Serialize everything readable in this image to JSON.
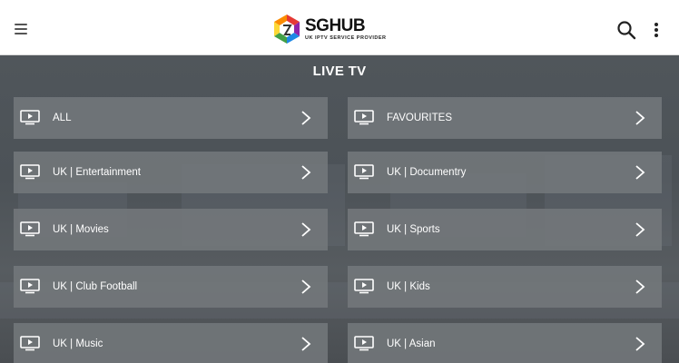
{
  "header": {
    "logo_text": "SGHUB",
    "logo_subtitle": "UK IPTV SERVICE PROVIDER",
    "menu_icon": "hamburger-menu-icon",
    "search_icon": "search-icon",
    "more_icon": "more-vertical-icon"
  },
  "page": {
    "title": "LIVE TV"
  },
  "categories": [
    {
      "label": "ALL"
    },
    {
      "label": "FAVOURITES"
    },
    {
      "label": "UK | Entertainment"
    },
    {
      "label": "UK | Documentry"
    },
    {
      "label": "UK | Movies"
    },
    {
      "label": "UK | Sports"
    },
    {
      "label": "UK | Club Football"
    },
    {
      "label": "UK | Kids"
    },
    {
      "label": "UK | Music"
    },
    {
      "label": "UK | Asian"
    }
  ],
  "colors": {
    "topbar": "#ffffff",
    "background": "#4a4f54",
    "tile": "#73777b",
    "text": "#ffffff"
  }
}
